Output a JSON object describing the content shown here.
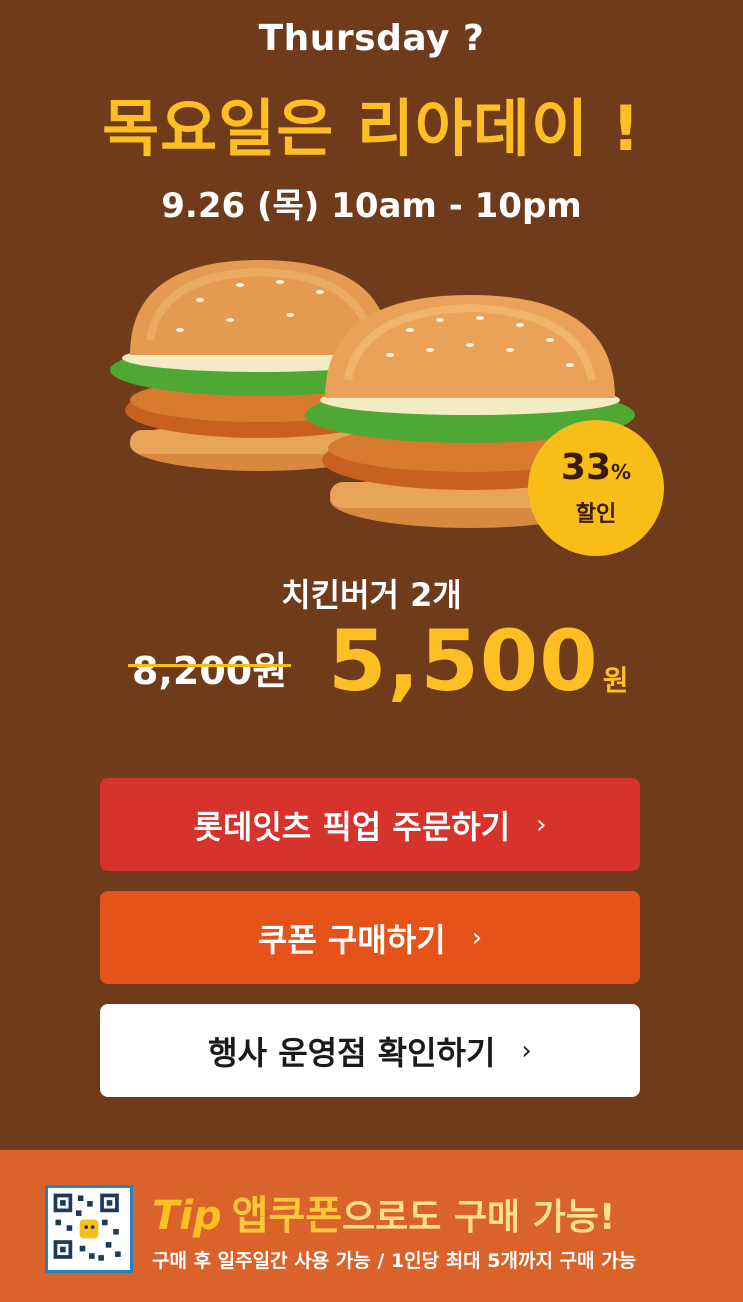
{
  "promo": {
    "eyebrow": "Thursday ?",
    "headline": "목요일은 리아데이 !",
    "datetime": "9.26 (목) 10am - 10pm"
  },
  "badge": {
    "percent": "33",
    "percent_unit": "%",
    "label": "할인"
  },
  "product": {
    "name": "치킨버거 2개",
    "old_price": "8,200원",
    "new_price": "5,500",
    "new_price_unit": "원"
  },
  "buttons": {
    "pickup": "롯데잇츠 픽업 주문하기",
    "coupon": "쿠폰 구매하기",
    "stores": "행사 운영점 확인하기",
    "chevron": "›"
  },
  "footer": {
    "tip": "Tip",
    "app_coupon": "앱쿠폰",
    "rest": "으로도 구매 가능!",
    "sub": "구매 후 일주일간 사용 가능 / 1인당 최대 5개까지 구매 가능"
  },
  "colors": {
    "background": "#6f3b1b",
    "accent_yellow": "#fdbf24",
    "button_red": "#d5332b",
    "button_orange": "#e5531a",
    "footer_orange": "#d9632a"
  }
}
